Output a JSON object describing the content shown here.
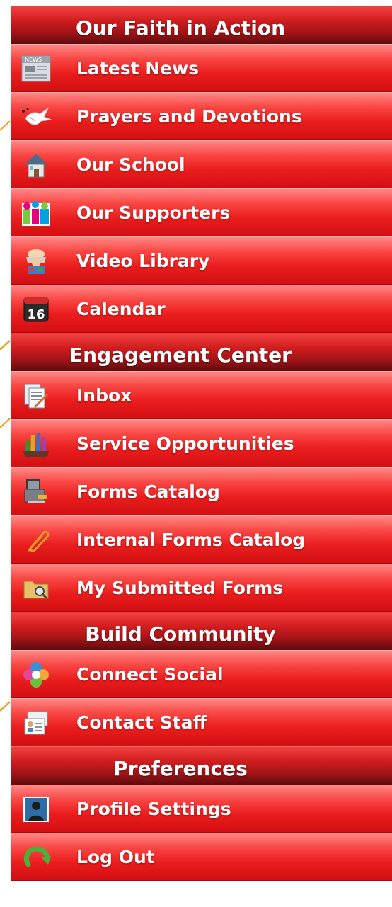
{
  "sections": [
    {
      "title": "Our Faith in Action",
      "items": [
        {
          "label": "Latest News",
          "icon": "newspaper-icon"
        },
        {
          "label": "Prayers and Devotions",
          "icon": "dove-icon"
        },
        {
          "label": "Our School",
          "icon": "house-icon"
        },
        {
          "label": "Our Supporters",
          "icon": "people-icon"
        },
        {
          "label": "Video Library",
          "icon": "movie-viewer-icon"
        },
        {
          "label": "Calendar",
          "icon": "calendar-icon",
          "icon_text": "16"
        }
      ]
    },
    {
      "title": "Engagement Center",
      "items": [
        {
          "label": "Inbox",
          "icon": "documents-icon"
        },
        {
          "label": "Service Opportunities",
          "icon": "hands-icon"
        },
        {
          "label": "Forms Catalog",
          "icon": "printer-icon"
        },
        {
          "label": "Internal Forms Catalog",
          "icon": "paperclip-icon"
        },
        {
          "label": "My Submitted Forms",
          "icon": "folder-search-icon"
        }
      ]
    },
    {
      "title": "Build Community",
      "items": [
        {
          "label": "Connect Social",
          "icon": "social-circle-icon"
        },
        {
          "label": "Contact Staff",
          "icon": "contact-cards-icon"
        }
      ]
    },
    {
      "title": "Preferences",
      "items": [
        {
          "label": "Profile Settings",
          "icon": "profile-person-icon"
        },
        {
          "label": "Log Out",
          "icon": "logout-arrow-icon"
        }
      ]
    }
  ],
  "colors": {
    "header": "#a21417",
    "item": "#ea1d1d",
    "text": "#ffffff",
    "arrow_accent": "#e7a11a"
  }
}
